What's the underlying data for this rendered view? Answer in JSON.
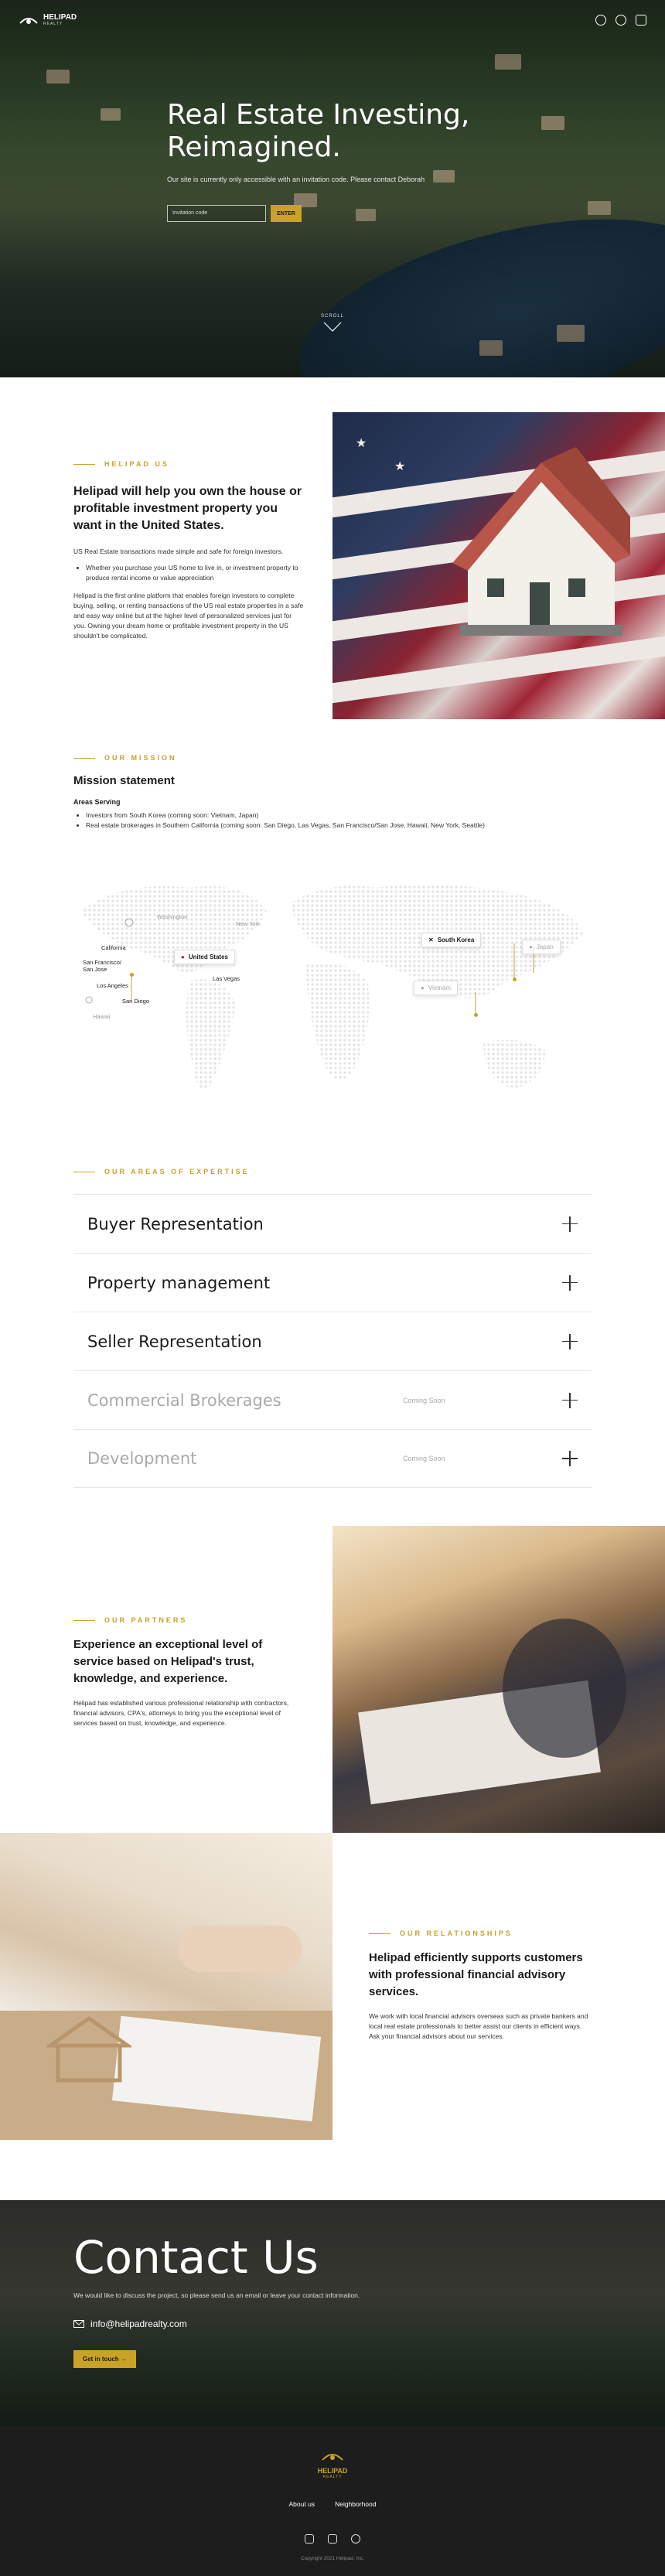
{
  "nav": {
    "brand": "HELIPAD",
    "brand_sub": "REALTY",
    "icons": [
      "globe-icon",
      "user-icon",
      "menu-icon"
    ]
  },
  "hero": {
    "title": "Real Estate Investing, Reimagined.",
    "tagline": "Our site is currently only accessible with an invitation code. Please contact Deborah",
    "input_placeholder": "Invitation code",
    "enter_label": "ENTER",
    "scroll_label": "SCROLL"
  },
  "intro": {
    "kicker": "HELIPAD US",
    "title": "Helipad will help you own the house or profitable investment property you want in the United States.",
    "p1": "US Real Estate transactions made simple and safe for foreign investors.",
    "bullet": "Whether you purchase your US home to live in, or investment property to produce rental income or value appreciation",
    "p2": "Helipad is the first online platform that enables foreign investors to complete buying, selling, or renting transactions of the US real estate properties in a safe and easy way online but at the higher level of personalized services just for you. Owning your dream home or profitable investment property in the US shouldn't be complicated."
  },
  "mission": {
    "kicker": "OUR MISSION",
    "title": "Mission statement",
    "areas_label": "Areas Serving",
    "items": [
      "Investors from South Korea (coming soon: Vietnam, Japan)",
      "Real estate brokerages in Southern California (coming soon: San Diego, Las Vegas, San Francisco/San Jose, Hawaii, New York, Seattle)"
    ]
  },
  "map": {
    "united_states": "United States",
    "south_korea": "South Korea",
    "japan": "Japan",
    "vietnam": "Vietnam",
    "cities": {
      "washington": "Washington",
      "new_york": "New York",
      "california": "California",
      "san_francisco": "San Francisco/\nSan Jose",
      "las_vegas": "Las Vegas",
      "los_angeles": "Los Angeles",
      "san_diego": "San Diego",
      "hawaii": "Hawaii"
    }
  },
  "expertise": {
    "kicker": "OUR AREAS OF EXPERTISE",
    "items": [
      {
        "label": "Buyer Representation",
        "status": ""
      },
      {
        "label": "Property management",
        "status": ""
      },
      {
        "label": "Seller Representation",
        "status": ""
      },
      {
        "label": "Commercial Brokerages",
        "status": "Coming Soon"
      },
      {
        "label": "Development",
        "status": "Coming Soon"
      }
    ]
  },
  "partners": {
    "kicker": "OUR PARTNERS",
    "title": "Experience an exceptional level of service based on Helipad's trust, knowledge, and experience.",
    "body": "Helipad has established various professional relationship with contractors, financial advisors, CPA's, attorneys to bring you the exceptional level of services based on trust, knowledge, and experience."
  },
  "relationships": {
    "kicker": "OUR RELATIONSHIPS",
    "title": "Helipad efficiently supports customers with professional financial advisory services.",
    "body": "We work with local financial advisors overseas such as private bankers and local real estate professionals to better assist our clients in efficient ways. Ask your financial advisors about our services."
  },
  "contact": {
    "title": "Contact Us",
    "desc": "We would like to discuss the project, so please send us an email or leave your contact information.",
    "email": "info@helipadrealty.com",
    "cta": "Get in touch →"
  },
  "footer": {
    "brand": "HELIPAD",
    "brand_sub": "REALTY",
    "links": [
      "About us",
      "Neighborhood"
    ],
    "copyright": "Copyright 2021 Helipad, Inc."
  },
  "colors": {
    "accent": "#c9a227",
    "dark": "#1d1d1d"
  }
}
